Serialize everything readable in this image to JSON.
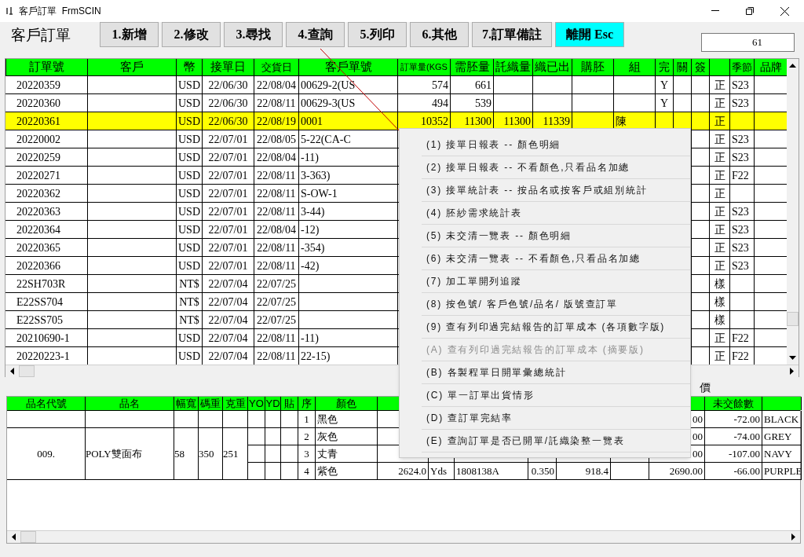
{
  "window": {
    "title": "客戶訂單  FrmSCIN"
  },
  "form_title": "客戶訂單",
  "toolbar": [
    {
      "label": "1.新增",
      "kind": "normal"
    },
    {
      "label": "2.修改",
      "kind": "normal"
    },
    {
      "label": "3.尋找",
      "kind": "normal"
    },
    {
      "label": "4.查詢",
      "kind": "normal"
    },
    {
      "label": "5.列印",
      "kind": "normal"
    },
    {
      "label": "6.其他",
      "kind": "normal"
    },
    {
      "label": "7.訂單備註",
      "kind": "wide"
    },
    {
      "label": "離開 Esc",
      "kind": "exit"
    }
  ],
  "lookup_field": {
    "value": "61"
  },
  "orders": {
    "columns": [
      {
        "label": "訂單號"
      },
      {
        "label": "客戶"
      },
      {
        "label": "幣"
      },
      {
        "label": "接單日"
      },
      {
        "label": "交貨日"
      },
      {
        "label": "客戶單號"
      },
      {
        "label": "訂單量(KGS"
      },
      {
        "label": "需胚量"
      },
      {
        "label": "託織量"
      },
      {
        "label": "織已出"
      },
      {
        "label": "購胚"
      },
      {
        "label": "組"
      },
      {
        "label": "完"
      },
      {
        "label": "關"
      },
      {
        "label": "簽"
      },
      {},
      {
        "label": "季節"
      },
      {
        "label": "品牌"
      }
    ],
    "rows": [
      {
        "selected": false,
        "cells": [
          "20220359",
          null,
          "USD",
          "22/06/30",
          "22/08/04",
          "00629-2(US",
          "574",
          "661",
          null,
          null,
          null,
          null,
          "Y",
          null,
          null,
          "正",
          "S23",
          null
        ]
      },
      {
        "selected": false,
        "cells": [
          "20220360",
          null,
          "USD",
          "22/06/30",
          "22/08/11",
          "00629-3(US",
          "494",
          "539",
          null,
          null,
          null,
          null,
          "Y",
          null,
          null,
          "正",
          "S23",
          null
        ]
      },
      {
        "selected": true,
        "cells": [
          "20220361",
          null,
          "USD",
          "22/06/30",
          "22/08/19",
          "0001",
          "10352",
          "11300",
          "11300",
          "11339",
          null,
          "陳",
          null,
          null,
          null,
          "正",
          null,
          null
        ]
      },
      {
        "selected": false,
        "cells": [
          "20220002",
          null,
          "USD",
          "22/07/01",
          "22/08/05",
          "5-22(CA-C",
          null,
          null,
          null,
          null,
          null,
          null,
          null,
          null,
          null,
          "正",
          "S23",
          null
        ]
      },
      {
        "selected": false,
        "cells": [
          "20220259",
          null,
          "USD",
          "22/07/01",
          "22/08/04",
          "-11)",
          null,
          null,
          null,
          null,
          null,
          null,
          null,
          null,
          null,
          "正",
          "S23",
          null
        ]
      },
      {
        "selected": false,
        "cells": [
          "20220271",
          null,
          "USD",
          "22/07/01",
          "22/08/11",
          "3-363)",
          null,
          null,
          null,
          null,
          null,
          null,
          null,
          null,
          null,
          "正",
          "F22",
          null
        ]
      },
      {
        "selected": false,
        "cells": [
          "20220362",
          null,
          "USD",
          "22/07/01",
          "22/08/11",
          "S-OW-1",
          null,
          null,
          null,
          null,
          null,
          null,
          null,
          null,
          null,
          "正",
          null,
          null
        ]
      },
      {
        "selected": false,
        "cells": [
          "20220363",
          null,
          "USD",
          "22/07/01",
          "22/08/11",
          "3-44)",
          null,
          null,
          null,
          null,
          null,
          null,
          null,
          null,
          null,
          "正",
          "S23",
          null
        ]
      },
      {
        "selected": false,
        "cells": [
          "20220364",
          null,
          "USD",
          "22/07/01",
          "22/08/04",
          "-12)",
          null,
          null,
          null,
          null,
          null,
          null,
          null,
          null,
          null,
          "正",
          "S23",
          null
        ]
      },
      {
        "selected": false,
        "cells": [
          "20220365",
          null,
          "USD",
          "22/07/01",
          "22/08/11",
          "-354)",
          null,
          null,
          null,
          null,
          null,
          null,
          null,
          null,
          null,
          "正",
          "S23",
          null
        ]
      },
      {
        "selected": false,
        "cells": [
          "20220366",
          null,
          "USD",
          "22/07/01",
          "22/08/11",
          "-42)",
          null,
          null,
          null,
          null,
          null,
          null,
          null,
          null,
          null,
          "正",
          "S23",
          null
        ]
      },
      {
        "selected": false,
        "cells": [
          "22SH703R",
          null,
          "NT$",
          "22/07/04",
          "22/07/25",
          null,
          null,
          null,
          null,
          null,
          null,
          null,
          null,
          null,
          null,
          "樣",
          null,
          null
        ]
      },
      {
        "selected": false,
        "cells": [
          "E22SS704",
          null,
          "NT$",
          "22/07/04",
          "22/07/25",
          null,
          null,
          null,
          null,
          null,
          null,
          null,
          null,
          null,
          null,
          "樣",
          null,
          null
        ]
      },
      {
        "selected": false,
        "cells": [
          "E22SS705",
          null,
          "NT$",
          "22/07/04",
          "22/07/25",
          null,
          null,
          null,
          null,
          null,
          null,
          null,
          null,
          null,
          null,
          "樣",
          null,
          null
        ]
      },
      {
        "selected": false,
        "cells": [
          "20210690-1",
          null,
          "USD",
          "22/07/04",
          "22/08/11",
          "-11)",
          null,
          null,
          null,
          null,
          null,
          null,
          null,
          null,
          null,
          "正",
          "F22",
          null
        ]
      },
      {
        "selected": false,
        "cells": [
          "20220223-1",
          null,
          "USD",
          "22/07/04",
          "22/08/11",
          "22-15)",
          null,
          null,
          null,
          null,
          null,
          null,
          null,
          null,
          null,
          "正",
          "F22",
          null
        ]
      }
    ]
  },
  "context_menu": {
    "items": [
      {
        "label": "(1) 接單日報表 -- 顏色明細",
        "disabled": false
      },
      {
        "label": "(2) 接單日報表 -- 不看顏色,只看品名加總",
        "disabled": false
      },
      {
        "label": "(3) 接單統計表 -- 按品名或按客戶或組別統計",
        "disabled": false
      },
      {
        "label": "(4) 胚紗需求統計表",
        "disabled": false
      },
      {
        "label": "(5) 未交清一覽表 -- 顏色明細",
        "disabled": false
      },
      {
        "label": "(6) 未交清一覽表 -- 不看顏色,只看品名加總",
        "disabled": false
      },
      {
        "label": "(7) 加工單開列追蹤",
        "disabled": false
      },
      {
        "label": "(8) 按色號/ 客戶色號/品名/ 版號查訂單",
        "disabled": false
      },
      {
        "label": "(9) 查有列印過完結報告的訂單成本 (各項數字版)",
        "disabled": false
      },
      {
        "label": "(A) 查有列印過完結報告的訂單成本 (摘要版)",
        "disabled": true
      },
      {
        "label": "(B) 各製程單日開單彙總統計",
        "disabled": false
      },
      {
        "label": "(C) 單一訂單出貨情形",
        "disabled": false
      },
      {
        "label": "(D) 查訂單完結率",
        "disabled": false
      },
      {
        "label": "(E) 查詢訂單是否已開單/託織染整一覽表",
        "disabled": false
      }
    ]
  },
  "detail": {
    "caption": "價",
    "columns": [
      {
        "label": "品名代號"
      },
      {
        "label": "品名"
      },
      {
        "label": "幅寬"
      },
      {
        "label": "碼重"
      },
      {
        "label": "克重"
      },
      {
        "label": "YO"
      },
      {
        "label": "YD"
      },
      {
        "label": "貼"
      },
      {
        "label": "序"
      },
      {
        "label": "顏色"
      },
      {},
      {},
      {},
      {},
      {},
      {},
      {},
      {
        "label": "未交餘數"
      },
      {}
    ],
    "rows": [
      {
        "cells": [
          null,
          null,
          null,
          null,
          null,
          null,
          null,
          null,
          "1",
          "黑色",
          null,
          null,
          null,
          null,
          null,
          null,
          "00",
          "-72.00",
          "BLACK"
        ]
      },
      {
        "cells": [
          "009.",
          "POLY雙面布",
          "58",
          "350",
          "251",
          null,
          null,
          null,
          "2",
          "灰色",
          null,
          null,
          null,
          null,
          null,
          null,
          "00",
          "-74.00",
          "GREY"
        ]
      },
      {
        "cells": [
          null,
          null,
          null,
          null,
          null,
          null,
          null,
          null,
          "3",
          "丈青",
          null,
          null,
          null,
          null,
          null,
          null,
          "00",
          "-107.00",
          "NAVY"
        ]
      },
      {
        "cells": [
          null,
          null,
          null,
          null,
          null,
          null,
          null,
          null,
          "4",
          "紫色",
          "2624.0",
          "Yds",
          "1808138A",
          "0.350",
          "918.4",
          null,
          "2690.00",
          "-66.00",
          "PURPLE"
        ]
      }
    ]
  }
}
